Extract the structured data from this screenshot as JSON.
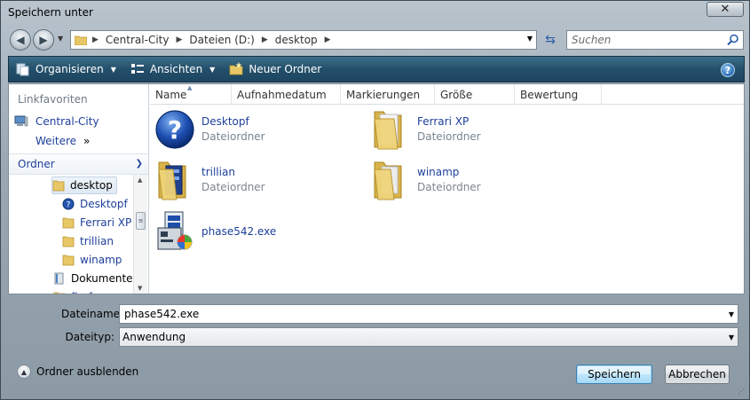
{
  "window": {
    "title": "Speichern unter",
    "close_glyph": "✕"
  },
  "address": {
    "breadcrumbs": [
      "Central-City",
      "Dateien (D:)",
      "desktop"
    ],
    "search_placeholder": "Suchen"
  },
  "toolbar": {
    "organize": "Organisieren",
    "views": "Ansichten",
    "new_folder": "Neuer Ordner",
    "help": "?"
  },
  "navpane": {
    "favorites_title": "Linkfavoriten",
    "favorites": [
      "Central-City",
      "Weitere"
    ],
    "more_glyph": "»",
    "folders_title": "Ordner",
    "tree": [
      {
        "label": "desktop",
        "icon": "folder-icon",
        "selected": true
      },
      {
        "label": "Desktopf",
        "icon": "help-folder-icon"
      },
      {
        "label": "Ferrari XP",
        "icon": "folder-icon"
      },
      {
        "label": "trillian",
        "icon": "folder-icon"
      },
      {
        "label": "winamp",
        "icon": "folder-icon"
      },
      {
        "label": "Dokumente",
        "icon": "documents-icon"
      },
      {
        "label": "firefox",
        "icon": "folder-icon"
      }
    ]
  },
  "columns": [
    "Name",
    "Aufnahmedatum",
    "Markierungen",
    "Größe",
    "Bewertung"
  ],
  "items": [
    {
      "name": "Desktopf",
      "type": "Dateiordner",
      "icon": "help-icon"
    },
    {
      "name": "Ferrari XP",
      "type": "Dateiordner",
      "icon": "folder-icon"
    },
    {
      "name": "trillian",
      "type": "Dateiordner",
      "icon": "folder-icon"
    },
    {
      "name": "winamp",
      "type": "Dateiordner",
      "icon": "folder-icon"
    },
    {
      "name": "phase542.exe",
      "type": "",
      "icon": "installer-icon"
    }
  ],
  "form": {
    "filename_label": "Dateiname:",
    "filename_value": "phase542.exe",
    "filetype_label": "Dateityp:",
    "filetype_value": "Anwendung"
  },
  "footer": {
    "hide_folders": "Ordner ausblenden",
    "save": "Speichern",
    "cancel": "Abbrechen"
  },
  "colors": {
    "toolbar": "#244f6a",
    "link": "#1e3f9a",
    "secondary_text": "#7a858f"
  }
}
